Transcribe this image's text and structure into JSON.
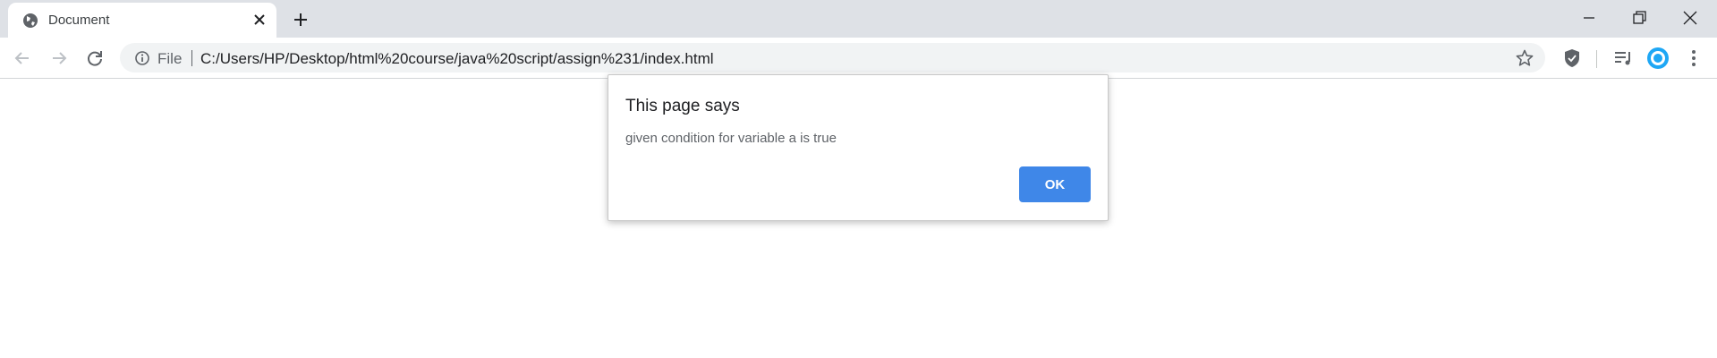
{
  "browser": {
    "tab": {
      "title": "Document",
      "favicon": "globe-icon"
    },
    "new_tab_icon": "plus-icon",
    "window_controls": [
      "minimize-icon",
      "restore-icon",
      "close-icon"
    ]
  },
  "toolbar": {
    "scheme_label": "File",
    "url": "C:/Users/HP/Desktop/html%20course/java%20script/assign%231/index.html",
    "icons": [
      "back-icon",
      "forward-icon",
      "reload-icon",
      "info-icon",
      "star-icon",
      "shield-extension-icon",
      "media-queue-icon",
      "profile-avatar-icon",
      "menu-icon"
    ]
  },
  "dialog": {
    "title": "This page says",
    "message": "given condition for variable a is true",
    "ok_label": "OK"
  },
  "colors": {
    "tab_strip": "#dee1e6",
    "omnibox": "#f1f3f4",
    "ok_button": "#3f87e8",
    "avatar": "#1ea7f5"
  }
}
